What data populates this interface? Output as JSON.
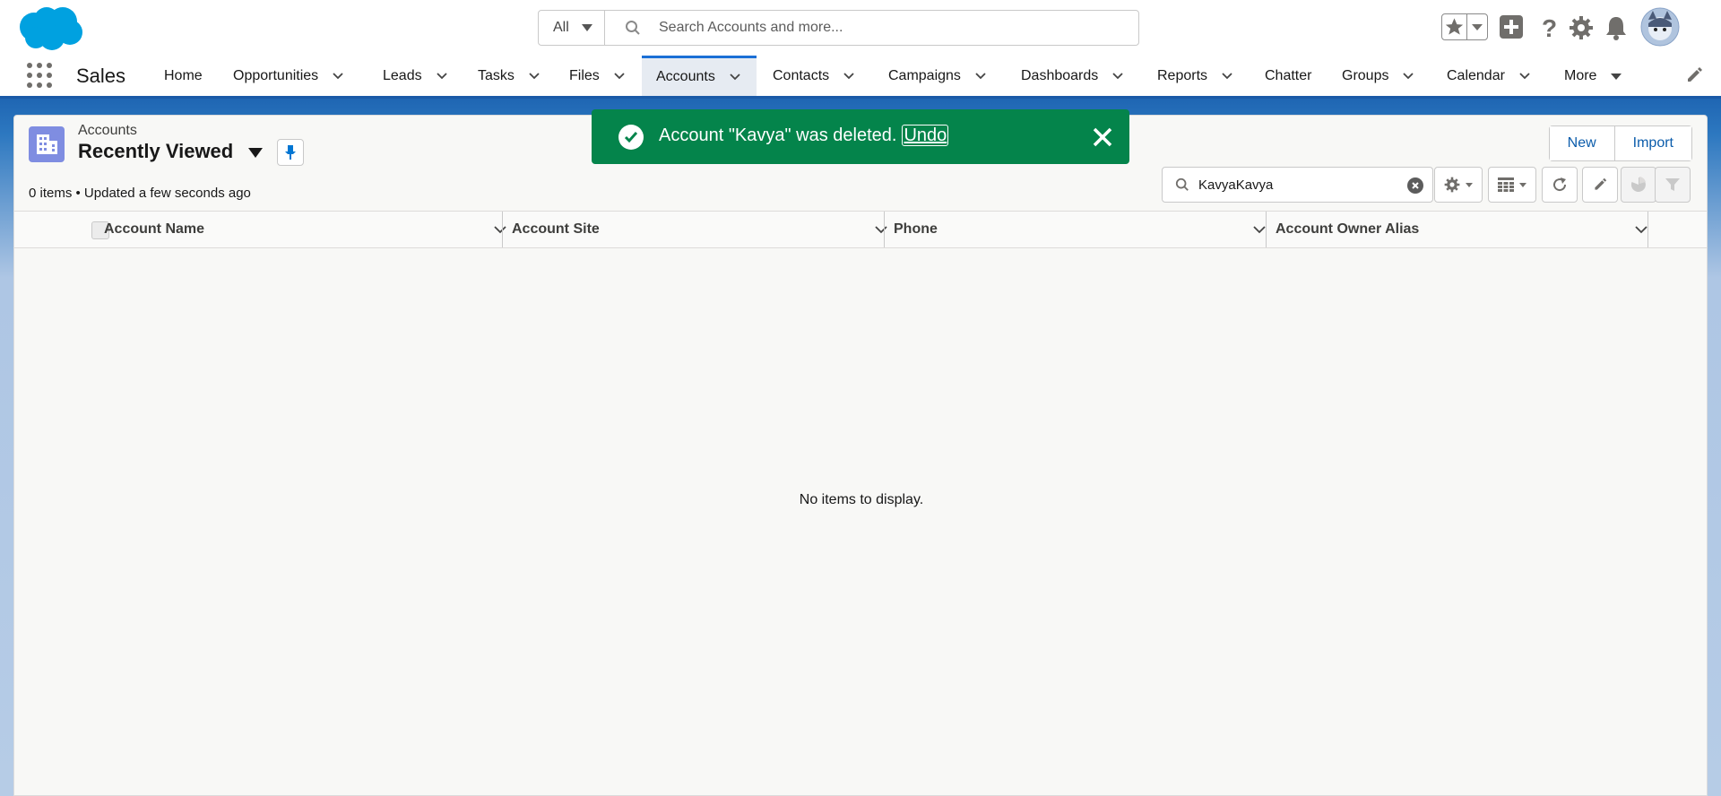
{
  "colors": {
    "brand": "#00a1e0",
    "nav_active": "#1b6fd6",
    "toast_success": "#04844b",
    "link": "#0b5cab",
    "object_icon": "#7f8de1"
  },
  "global_search": {
    "scope": "All",
    "placeholder": "Search Accounts and more..."
  },
  "header_icons": [
    "favorites-star-icon",
    "favorites-dropdown-icon",
    "global-actions-plus-icon",
    "help-question-icon",
    "setup-gear-icon",
    "notifications-bell-icon",
    "user-avatar"
  ],
  "app": {
    "name": "Sales"
  },
  "nav": {
    "items": [
      {
        "label": "Home",
        "has_menu": false
      },
      {
        "label": "Opportunities",
        "has_menu": true
      },
      {
        "label": "Leads",
        "has_menu": true
      },
      {
        "label": "Tasks",
        "has_menu": true
      },
      {
        "label": "Files",
        "has_menu": true
      },
      {
        "label": "Accounts",
        "has_menu": true,
        "active": true
      },
      {
        "label": "Contacts",
        "has_menu": true
      },
      {
        "label": "Campaigns",
        "has_menu": true
      },
      {
        "label": "Dashboards",
        "has_menu": true
      },
      {
        "label": "Reports",
        "has_menu": true
      },
      {
        "label": "Chatter",
        "has_menu": false
      },
      {
        "label": "Groups",
        "has_menu": true
      },
      {
        "label": "Calendar",
        "has_menu": true
      },
      {
        "label": "More",
        "has_menu": true
      }
    ]
  },
  "list_view": {
    "object_label": "Accounts",
    "title": "Recently Viewed",
    "meta": "0 items • Updated a few seconds ago",
    "actions": {
      "new": "New",
      "import": "Import"
    },
    "search_value": "KavyaKavya",
    "columns": [
      "Account Name",
      "Account Site",
      "Phone",
      "Account Owner Alias"
    ],
    "empty_message": "No items to display."
  },
  "toast": {
    "message": "Account \"Kavya\" was deleted.",
    "undo_label": "Undo"
  }
}
